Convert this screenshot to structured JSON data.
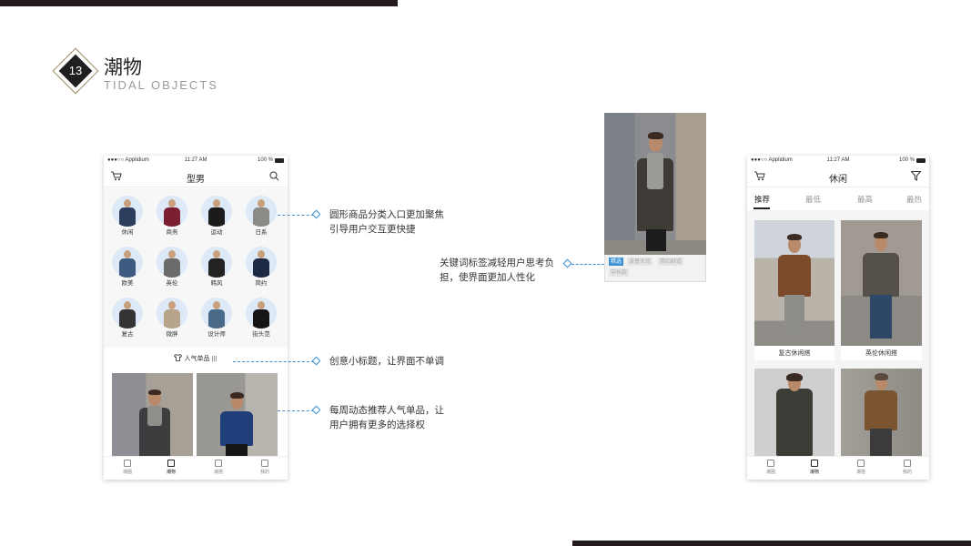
{
  "header": {
    "number": "13",
    "title_cn": "潮物",
    "title_en": "TIDAL OBJECTS"
  },
  "phone_left": {
    "status": {
      "carrier": "●●●○○ Applidium",
      "time": "11:27 AM",
      "battery": "100 %"
    },
    "nav_title": "型男",
    "categories": [
      "休闲",
      "商务",
      "运动",
      "日系",
      "欧美",
      "英伦",
      "韩风",
      "简约",
      "复古",
      "微胖",
      "设计师",
      "街头范"
    ],
    "section_title": "人气单品",
    "tabs": [
      "潮圈",
      "潮物",
      "潮搭",
      "我的"
    ]
  },
  "callouts": {
    "category": [
      "圆形商品分类入口更加聚焦",
      "引导用户交互更快捷"
    ],
    "subtitle": [
      "创意小标题，让界面不单调"
    ],
    "weekly": [
      "每周动态推荐人气单品，让",
      "用户拥有更多的选择权"
    ],
    "tags": [
      "关键词标签减轻用户思考负",
      "担，使界面更加人性化"
    ]
  },
  "tag_card": {
    "tags": [
      "精选",
      "波普大衣",
      "简约舒适",
      "中长款"
    ]
  },
  "phone_right": {
    "status": {
      "carrier": "●●●○○ Applidium",
      "time": "11:27 AM",
      "battery": "100 %"
    },
    "nav_title": "休闲",
    "filter_tabs": [
      "推荐",
      "最低",
      "最高",
      "最热"
    ],
    "products": [
      "复古休闲搭",
      "英伦休闲搭"
    ],
    "tabs": [
      "潮圈",
      "潮物",
      "潮搭",
      "我的"
    ]
  },
  "colors": {
    "accent": "#3b8fd4",
    "badge_border": "#a08866",
    "dark_bar": "#231a1e"
  }
}
